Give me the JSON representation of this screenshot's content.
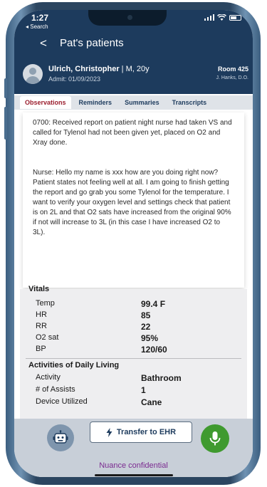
{
  "status": {
    "time": "1:27",
    "back_label": "◂ Search"
  },
  "nav": {
    "back_symbol": "<",
    "title": "Pat's patients"
  },
  "patient": {
    "name": "Ulrich, Christopher",
    "meta": " | M, 20y",
    "admit": "Admit: 01/09/2023",
    "room": "Room 425",
    "doctor": "J. Hanks, D.O."
  },
  "tabs": [
    {
      "label": "Observations",
      "active": true
    },
    {
      "label": "Reminders",
      "active": false
    },
    {
      "label": "Summaries",
      "active": false
    },
    {
      "label": "Transcripts",
      "active": false
    }
  ],
  "notes": [
    "0700: Received report on patient night nurse had taken VS and called for Tylenol had not been given yet, placed on O2 and Xray done.",
    "Nurse: Hello my name is xxx how are you doing right now? Patient states not feeling well at all. I am going to finish getting the report and go grab you some Tylenol for the temperature. I want to verify your oxygen level and settings check that patient is on 2L and that O2 sats have increased from the original 90% if not will increase to 3L (in this case I have increased O2 to 3L)."
  ],
  "vitals": {
    "title": "Vitals",
    "rows": [
      {
        "label": "Temp",
        "value": "99.4 F"
      },
      {
        "label": "HR",
        "value": "85"
      },
      {
        "label": "RR",
        "value": "22"
      },
      {
        "label": "O2 sat",
        "value": "95%"
      },
      {
        "label": "BP",
        "value": "120/60"
      }
    ]
  },
  "adl": {
    "title": "Activities of Daily Living",
    "rows": [
      {
        "label": "Activity",
        "value": "Bathroom"
      },
      {
        "label": "# of Assists",
        "value": "1"
      },
      {
        "label": "Device Utilized",
        "value": "Cane"
      }
    ]
  },
  "footer": {
    "transfer_label": "Transfer to EHR",
    "confidential": "Nuance confidential"
  },
  "icons": {
    "bot": "robot-assistant-icon",
    "transfer": "lightning-bolt-icon",
    "mic": "microphone-icon"
  },
  "colors": {
    "header_bg": "#1d3b5d",
    "active_tab_text": "#9b1e2e",
    "mic_green": "#3f9a2f",
    "confidential_text": "#7b2a90"
  }
}
